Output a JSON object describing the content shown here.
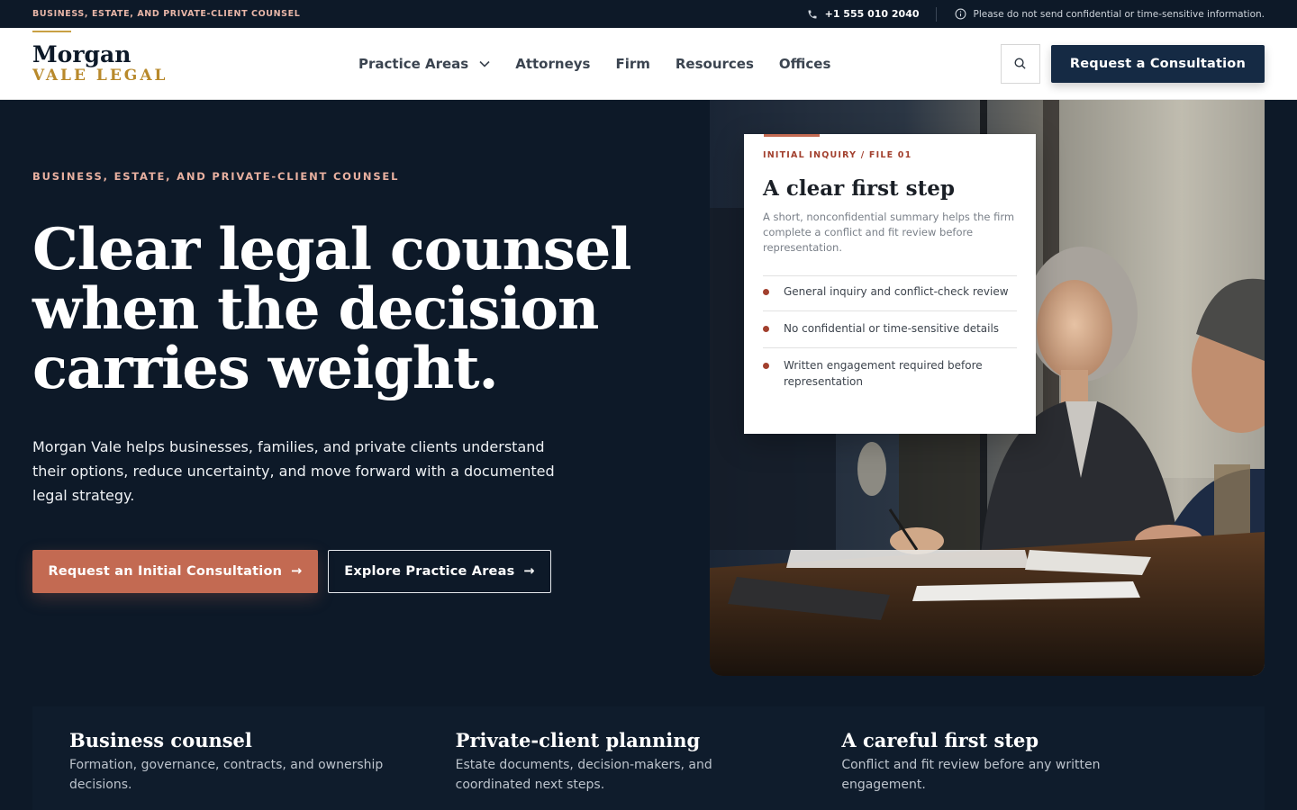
{
  "topbar": {
    "eyebrow": "BUSINESS, ESTATE, AND PRIVATE-CLIENT COUNSEL",
    "phone": "+1 555 010 2040",
    "notice": "Please do not send confidential or time-sensitive information."
  },
  "header": {
    "logo_name": "Morgan",
    "logo_sub": "VALE LEGAL",
    "nav": [
      {
        "label": "Practice Areas",
        "icon": "chevron-down-icon"
      },
      {
        "label": "Attorneys"
      },
      {
        "label": "Firm"
      },
      {
        "label": "Resources"
      },
      {
        "label": "Offices"
      }
    ],
    "search_icon": "search-icon",
    "cta": "Request a Consultation"
  },
  "hero": {
    "eyebrow": "BUSINESS, ESTATE, AND PRIVATE-CLIENT COUNSEL",
    "title_lines": [
      "Clear legal counsel",
      "when the decision",
      "carries weight."
    ],
    "body": "Morgan Vale helps businesses, families, and private clients understand their options, reduce uncertainty, and move forward with a documented legal strategy.",
    "primary_cta": "Request an Initial Consultation",
    "secondary_cta": "Explore Practice Areas",
    "arrow": "→"
  },
  "card": {
    "tag": "INITIAL INQUIRY / FILE 01",
    "title": "A clear first step",
    "desc": "A short, nonconfidential summary helps the firm complete a conflict and fit review before representation.",
    "items": [
      "General inquiry and conflict-check review",
      "No confidential or time-sensitive details",
      "Written engagement required before representation"
    ]
  },
  "features": [
    {
      "title": "Business counsel",
      "desc": "Formation, governance, contracts, and ownership decisions."
    },
    {
      "title": "Private-client planning",
      "desc": "Estate documents, decision-makers, and coordinated next steps."
    },
    {
      "title": "A careful first step",
      "desc": "Conflict and fit review before any written engagement."
    }
  ],
  "colors": {
    "navy": "#0d1928",
    "accent_terracotta": "#c36a52",
    "gold": "#b8892b",
    "button_navy": "#152a44"
  }
}
